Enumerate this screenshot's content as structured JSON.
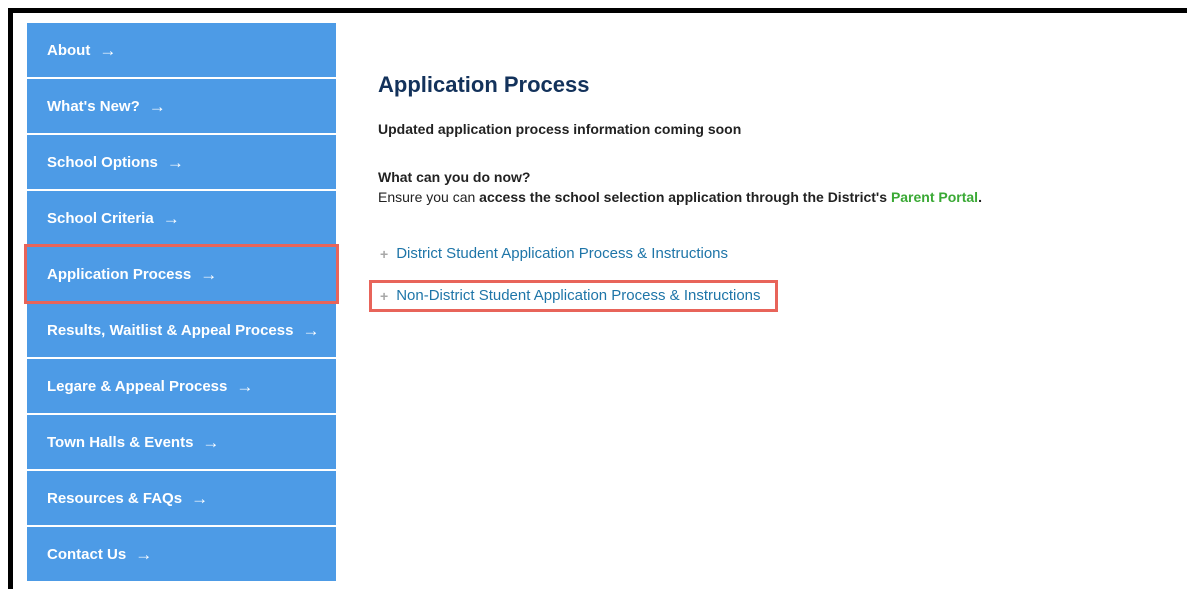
{
  "caption": "...pplication Process section of School Assignment Page",
  "sidebar": {
    "items": [
      {
        "label": "About"
      },
      {
        "label": "What's New?"
      },
      {
        "label": "School Options"
      },
      {
        "label": "School Criteria"
      },
      {
        "label": "Application Process"
      },
      {
        "label": "Results, Waitlist & Appeal Process"
      },
      {
        "label": "Legare & Appeal Process"
      },
      {
        "label": "Town Halls & Events"
      },
      {
        "label": "Resources & FAQs"
      },
      {
        "label": "Contact Us"
      }
    ],
    "arrow_glyph": "→",
    "color": "#4d9be6",
    "highlight_color": "#e8645a"
  },
  "main": {
    "title": "Application Process",
    "updated": "Updated application process information coming soon",
    "what_can": "What can you do now?",
    "ensure_prefix": "Ensure you can ",
    "ensure_bold": "access the school selection application through the District's ",
    "portal_link": "Parent Portal",
    "ensure_suffix": ".",
    "accordion": [
      {
        "label": "District Student Application Process & Instructions"
      },
      {
        "label": "Non-District Student Application Process & Instructions"
      }
    ],
    "plus_glyph": "+",
    "title_color": "#13325b",
    "link_color": "#1e75a8",
    "portal_color": "#3aa935"
  }
}
